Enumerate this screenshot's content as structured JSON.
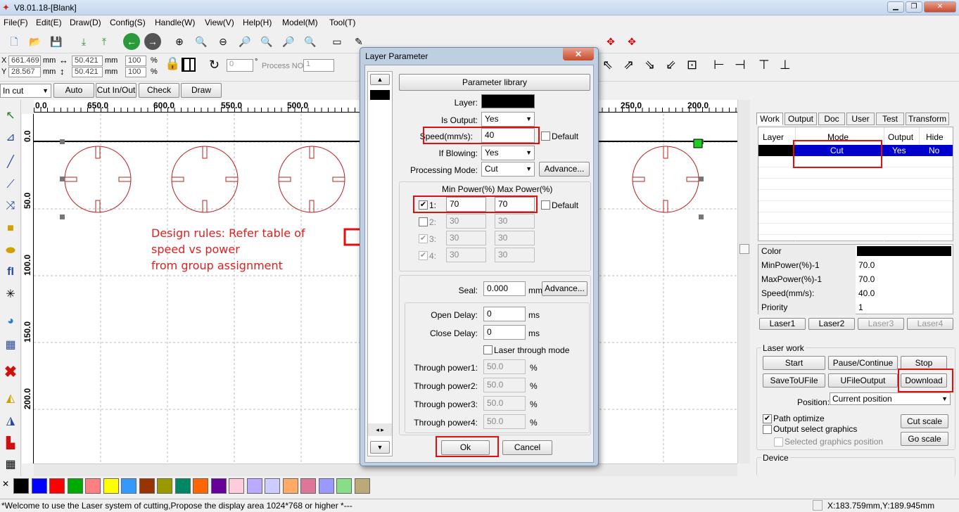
{
  "app": {
    "title": "V8.01.18-[Blank]"
  },
  "window_controls": {
    "minimize": "▁",
    "restore": "❐",
    "close": "✕"
  },
  "menu": [
    "File(F)",
    "Edit(E)",
    "Draw(D)",
    "Config(S)",
    "Handle(W)",
    "View(V)",
    "Help(H)",
    "Model(M)",
    "Tool(T)"
  ],
  "coords": {
    "x_label": "X",
    "x_value": "661.469",
    "y_label": "Y",
    "y_value": "28.567",
    "unit": "mm",
    "w_value": "50.421",
    "h_value": "50.421",
    "pct1": "100",
    "pct2": "100",
    "pct_unit": "%",
    "angle": "0",
    "deg": "°",
    "process_label": "Process NO:",
    "process_value": "1"
  },
  "toolbar3": {
    "mode_select": "In cut",
    "auto": "Auto",
    "cut_in_out": "Cut In/Out",
    "check": "Check",
    "draw": "Draw"
  },
  "ruler_top": [
    "0.0",
    "650.0",
    "600.0",
    "550.0",
    "500.0",
    "250.0",
    "200.0"
  ],
  "ruler_left": [
    "0.0",
    "50.0",
    "100.0",
    "150.0",
    "200.0"
  ],
  "annotation": {
    "line1": "Design rules: Refer table of",
    "line2": "speed vs power",
    "line3": "from group assignment"
  },
  "dialog": {
    "title": "Layer Parameter",
    "param_library": "Parameter library",
    "layer_label": "Layer:",
    "is_output_label": "Is Output:",
    "is_output_value": "Yes",
    "speed_label": "Speed(mm/s):",
    "speed_value": "40",
    "default_label": "Default",
    "if_blowing_label": "If Blowing:",
    "if_blowing_value": "Yes",
    "processing_mode_label": "Processing Mode:",
    "processing_mode_value": "Cut",
    "advance": "Advance...",
    "power_header": "Min Power(%) Max Power(%)",
    "powers": [
      {
        "label": "1:",
        "min": "70",
        "max": "70"
      },
      {
        "label": "2:",
        "min": "30",
        "max": "30"
      },
      {
        "label": "3:",
        "min": "30",
        "max": "30"
      },
      {
        "label": "4:",
        "min": "30",
        "max": "30"
      }
    ],
    "power_default": "Default",
    "seal_label": "Seal:",
    "seal_value": "0.000",
    "seal_unit": "mm",
    "seal_advance": "Advance...",
    "open_delay_label": "Open Delay:",
    "open_delay_value": "0",
    "close_delay_label": "Close Delay:",
    "close_delay_value": "0",
    "ms": "ms",
    "laser_through_mode": "Laser through mode",
    "through": [
      {
        "label": "Through power1:",
        "value": "50.0"
      },
      {
        "label": "Through power2:",
        "value": "50.0"
      },
      {
        "label": "Through power3:",
        "value": "50.0"
      },
      {
        "label": "Through power4:",
        "value": "50.0"
      }
    ],
    "pct": "%",
    "ok": "Ok",
    "cancel": "Cancel"
  },
  "right": {
    "tabs": [
      "Work",
      "Output",
      "Doc",
      "User",
      "Test",
      "Transform"
    ],
    "layer_table_headers": [
      "Layer",
      "Mode",
      "Output",
      "Hide"
    ],
    "layer_row": {
      "mode": "Cut",
      "output": "Yes",
      "hide": "No"
    },
    "props": [
      {
        "k": "Color",
        "v": ""
      },
      {
        "k": "MinPower(%)-1",
        "v": "70.0"
      },
      {
        "k": "MaxPower(%)-1",
        "v": "70.0"
      },
      {
        "k": "Speed(mm/s):",
        "v": "40.0"
      },
      {
        "k": "Priority",
        "v": "1"
      }
    ],
    "laser_tabs": [
      "Laser1",
      "Laser2",
      "Laser3",
      "Laser4"
    ],
    "laser_work": "Laser work",
    "start": "Start",
    "pause": "Pause/Continue",
    "stop": "Stop",
    "save_u": "SaveToUFile",
    "ufile_output": "UFileOutput",
    "download": "Download",
    "position_label": "Position:",
    "position_value": "Current position",
    "path_optimize": "Path optimize",
    "output_select": "Output select graphics",
    "selected_pos": "Selected graphics position",
    "cut_scale": "Cut scale",
    "go_scale": "Go scale",
    "device": "Device"
  },
  "palette": [
    "#000000",
    "#0000ff",
    "#ff0000",
    "#00aa00",
    "#ff8080",
    "#ffff00",
    "#3399ff",
    "#993300",
    "#999900",
    "#008866",
    "#ff6600",
    "#660099",
    "#ffccdd",
    "#bbaaff",
    "#ccccff",
    "#ffaa66",
    "#dd7799",
    "#9999ff",
    "#88dd88",
    "#bbaa77"
  ],
  "status": {
    "message": "*Welcome to use the Laser system of cutting,Propose the display area 1024*768 or higher *---",
    "coords": "X:183.759mm,Y:189.945mm"
  },
  "colors": {
    "accent": "#e01010",
    "selection": "#0000cc"
  }
}
